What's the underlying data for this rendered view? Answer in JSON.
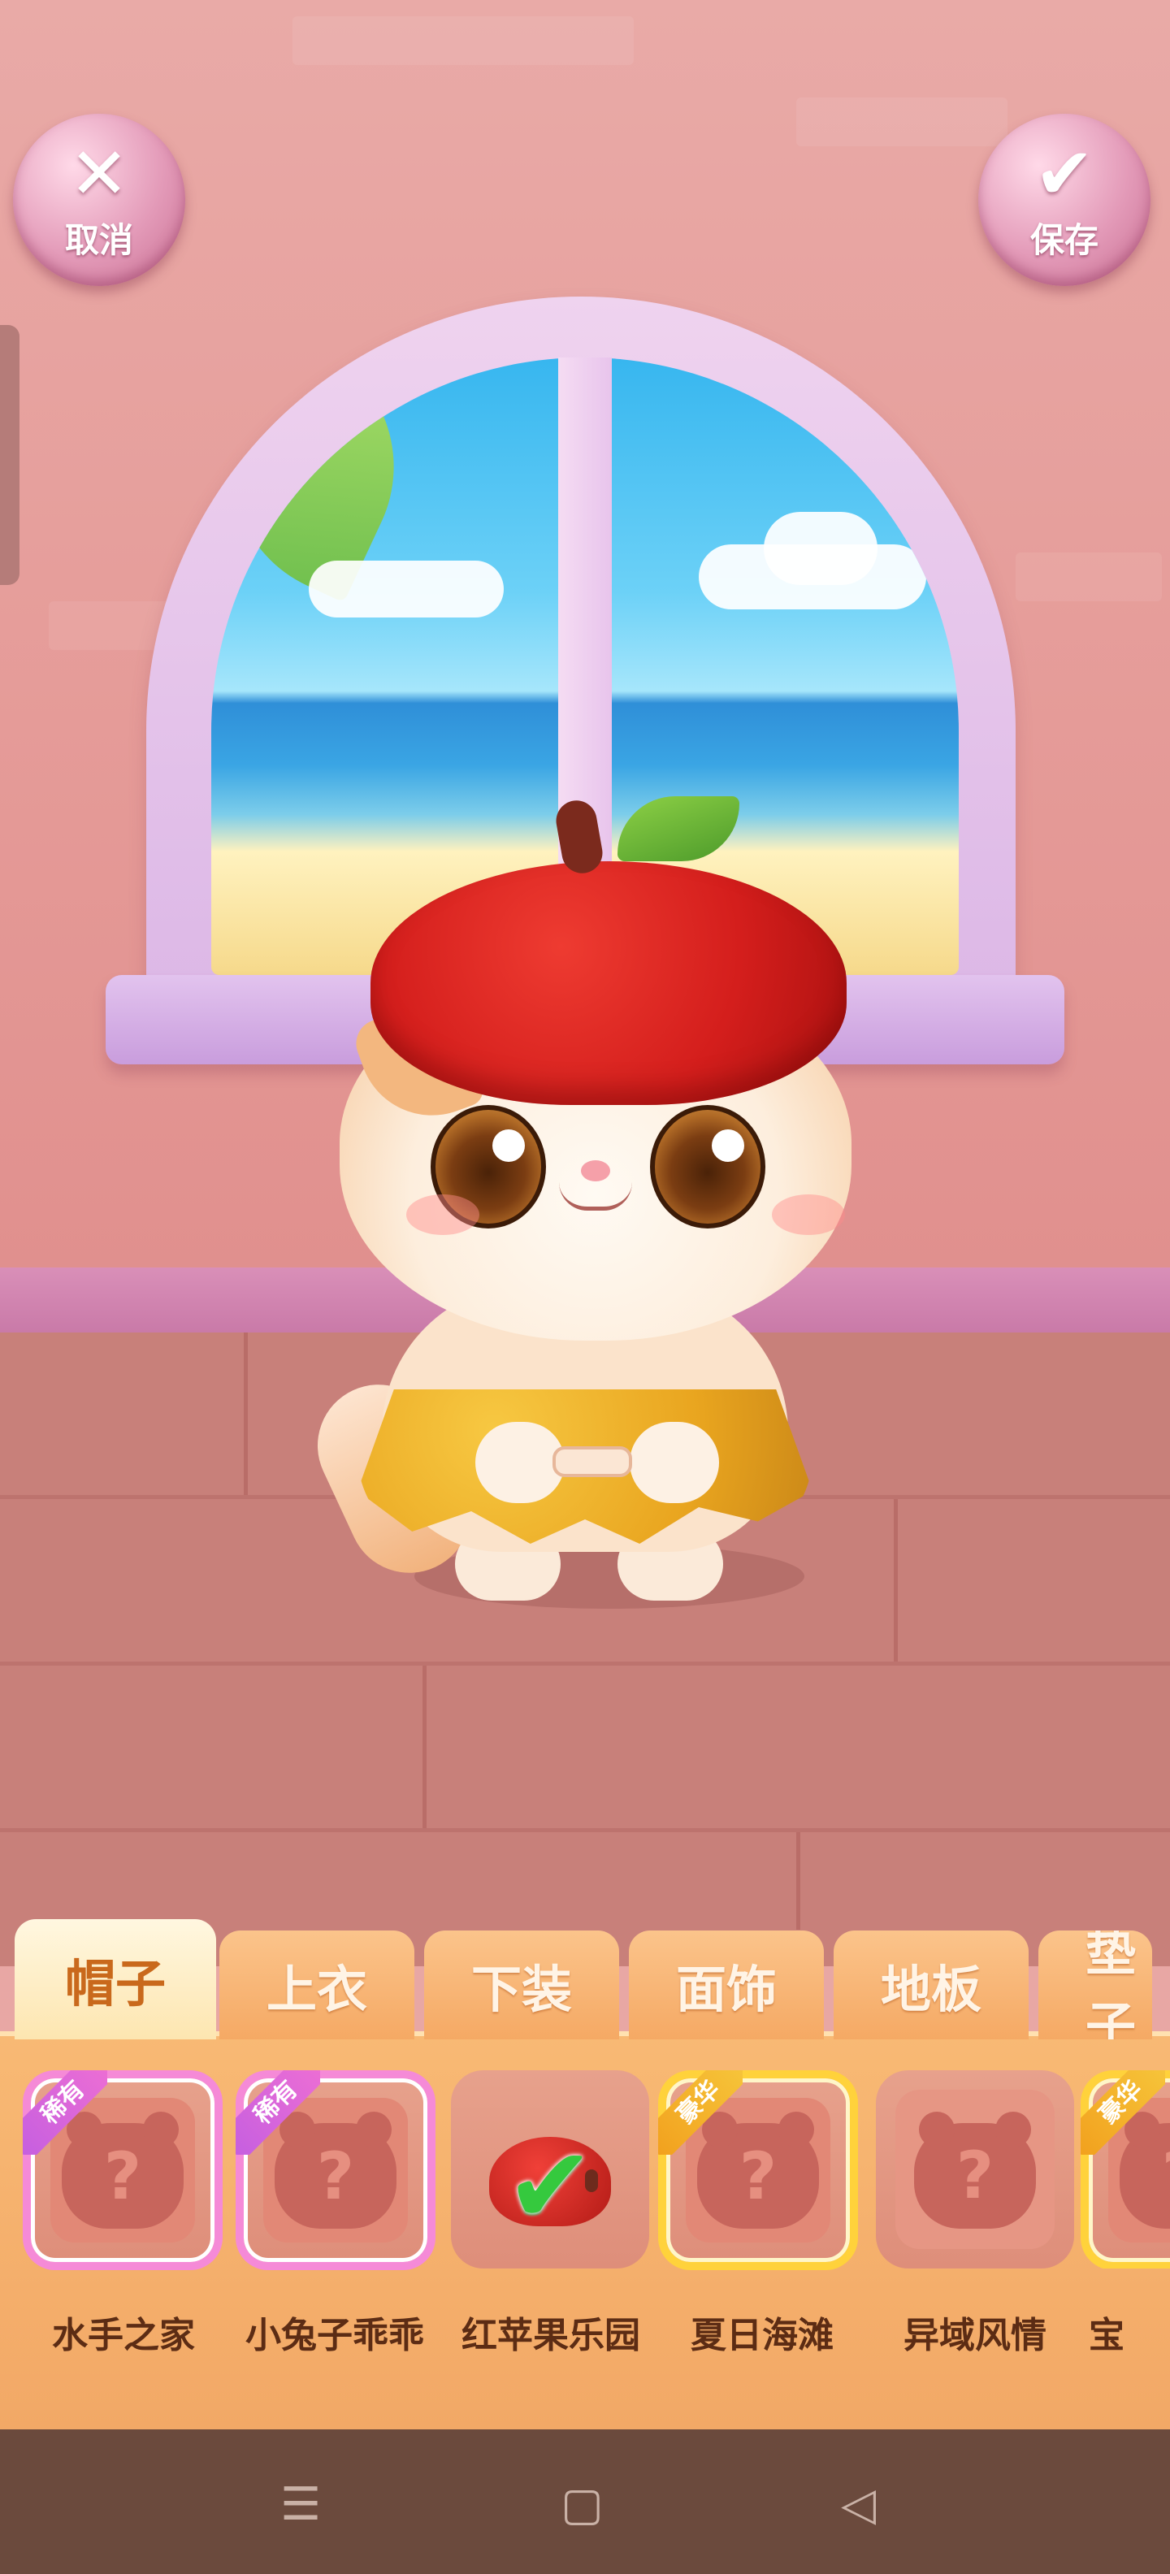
{
  "header": {
    "cancel_label": "取消",
    "save_label": "保存"
  },
  "tabs": [
    {
      "label": "帽子",
      "active": true
    },
    {
      "label": "上衣",
      "active": false
    },
    {
      "label": "下装",
      "active": false
    },
    {
      "label": "面饰",
      "active": false
    },
    {
      "label": "地板",
      "active": false
    },
    {
      "label": "垫子",
      "active": false
    }
  ],
  "items": [
    {
      "label": "水手之家",
      "badge": "稀有",
      "tier": "rare",
      "locked": true
    },
    {
      "label": "小兔子乖乖",
      "badge": "稀有",
      "tier": "rare",
      "locked": true
    },
    {
      "label": "红苹果乐园",
      "badge": "",
      "tier": "normal",
      "locked": false,
      "selected": true
    },
    {
      "label": "夏日海滩",
      "badge": "豪华",
      "tier": "deluxe",
      "locked": true
    },
    {
      "label": "异域风情",
      "badge": "",
      "tier": "normal",
      "locked": true
    },
    {
      "label": "宝",
      "badge": "豪华",
      "tier": "deluxe",
      "locked": true
    }
  ],
  "icons": {
    "cancel": "close-icon",
    "save": "check-icon",
    "locked_item": "cat-silhouette-question-icon",
    "selected_item": "apple-hat-icon",
    "nav_menu": "menu-icon",
    "nav_home": "home-icon",
    "nav_back": "back-icon"
  },
  "colors": {
    "rare_border": "#f58ad7",
    "deluxe_border": "#ffd23b",
    "panel": "#f8b974",
    "active_tab_text": "#c9691c",
    "item_label": "#5c2c14"
  }
}
